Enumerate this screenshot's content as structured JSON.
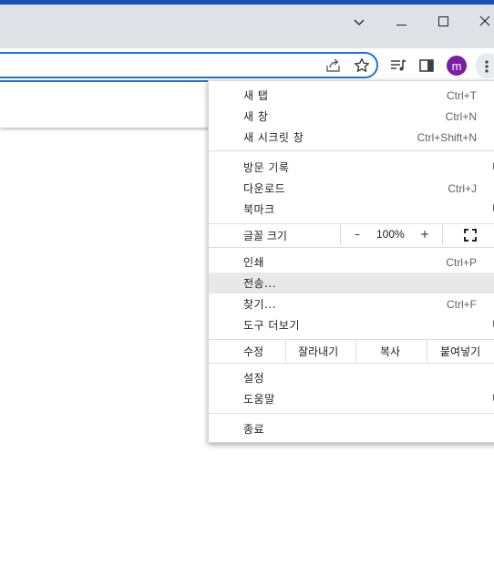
{
  "window": {
    "controls": [
      "chevron-down",
      "minimize",
      "maximize",
      "close"
    ]
  },
  "toolbar": {
    "avatar_letter": "m",
    "accent_color": "#1a73e8",
    "avatar_color": "#7b1fa2"
  },
  "menu": {
    "new_tab": "새 탭",
    "new_tab_sc": "Ctrl+T",
    "new_window": "새 창",
    "new_window_sc": "Ctrl+N",
    "incognito": "새 시크릿 창",
    "incognito_sc": "Ctrl+Shift+N",
    "history": "방문 기록",
    "downloads": "다운로드",
    "downloads_sc": "Ctrl+J",
    "bookmarks": "북마크",
    "zoom_label": "글꼴 크기",
    "zoom_minus": "–",
    "zoom_value": "100%",
    "zoom_plus": "+",
    "print": "인쇄",
    "print_sc": "Ctrl+P",
    "cast": "전송...",
    "find": "찾기...",
    "find_sc": "Ctrl+F",
    "more_tools": "도구 더보기",
    "edit_label": "수정",
    "cut": "잘라내기",
    "copy": "복사",
    "paste": "붙여넣기",
    "settings": "설정",
    "help": "도움말",
    "exit": "종료"
  }
}
